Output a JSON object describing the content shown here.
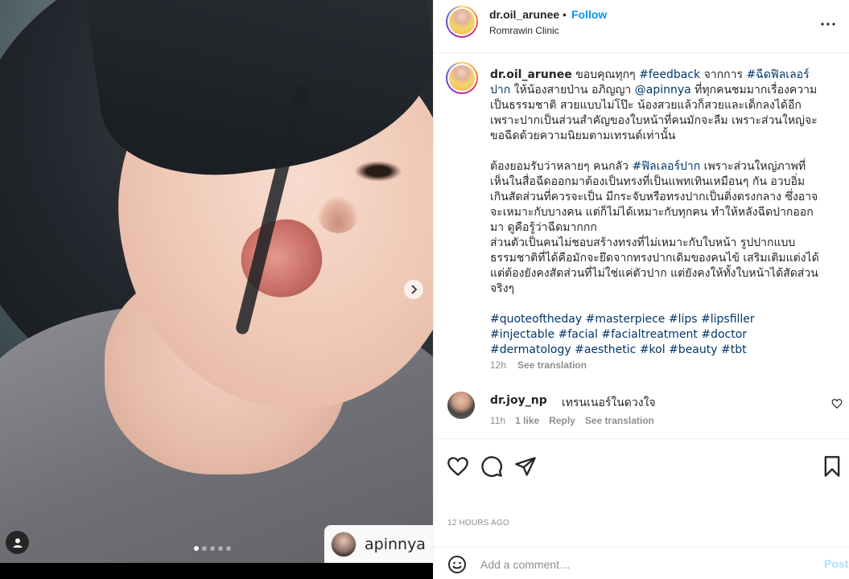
{
  "post": {
    "tagged_username": "apinnya",
    "carousel_total": 5,
    "carousel_active_index": 0
  },
  "header": {
    "username": "dr.oil_arunee",
    "separator": "•",
    "follow_label": "Follow",
    "location": "Romrawin Clinic"
  },
  "caption": {
    "username": "dr.oil_arunee",
    "p1_part1": " ขอบคุณทุกๆ ",
    "p1_tag1": "#feedback",
    "p1_part2": " จากการ ",
    "p1_tag2": "#ฉีดฟิลเลอร์ปาก",
    "p1_part3": " ให้น้องสายป่าน อภิญญา ",
    "p1_mention": "@apinnya",
    "p1_part4": " ที่ทุกคนชมมากเรื่องความเป็นธรรมชาติ สวยแบบไม่โป๊ะ น้องสวยแล้วก็สวยและเด็กลงได้อีก เพราะปากเป็นส่วนสำคัญของใบหน้าที่คนมักจะลืม เพราะส่วนใหญ่จะขอฉีดด้วยความนิยมตามเทรนด์เท่านั้น",
    "p2_part1": "ต้องยอมรับว่าหลายๆ คนกลัว ",
    "p2_tag": "#ฟิลเลอร์ปาก",
    "p2_part2": " เพราะส่วนใหญ่ภาพที่เห็นในสื่อฉีดออกมาต้องเป็นทรงที่เป็นแพทเทินเหมือนๆ กัน อวบอิ่มเกินสัดส่วนที่ควรจะเป็น มีกระจับหรือทรงปากเป็นติ่งตรงกลาง ซึ่งอาจจะเหมาะกับบางคน แต่ก็ไม่ได้เหมาะกับทุกคน ทำให้หลังฉีดปากออกมา ดูคือรู้ว่าฉีดมากกก",
    "p3": "ส่วนตัวเป็นคนไม่ชอบสร้างทรงที่ไม่เหมาะกับใบหน้า รูปปากแบบธรรมชาติที่ได้คือมักจะยึดจากทรงปากเดิมของคนไข้ เสริมเติมแต่งได้ แต่ต้องยังคงสัดส่วนที่ไม่ใช่แค่ตัวปาก แต่ยังคงให้ทั้งใบหน้าได้สัดส่วนจริงๆ",
    "hashtags": [
      "#quoteoftheday",
      "#masterpiece",
      "#lips",
      "#lipsfiller",
      "#injectable",
      "#facial",
      "#facialtreatment",
      "#doctor",
      "#dermatology",
      "#aesthetic",
      "#kol",
      "#beauty",
      "#tbt"
    ],
    "time": "12h",
    "see_translation": "See translation"
  },
  "comment": {
    "username": "dr.joy_np",
    "text": "เทรนเนอร์ในดวงใจ",
    "time": "11h",
    "likes": "1 like",
    "reply": "Reply",
    "see_translation": "See translation"
  },
  "actions": {
    "time_ago": "12 HOURS AGO"
  },
  "add_comment": {
    "placeholder": "Add a comment…",
    "post_label": "Post"
  },
  "colors": {
    "link": "#00376b",
    "follow": "#0095f6",
    "post_disabled": "#b2dffc",
    "muted": "#8e8e8e"
  }
}
